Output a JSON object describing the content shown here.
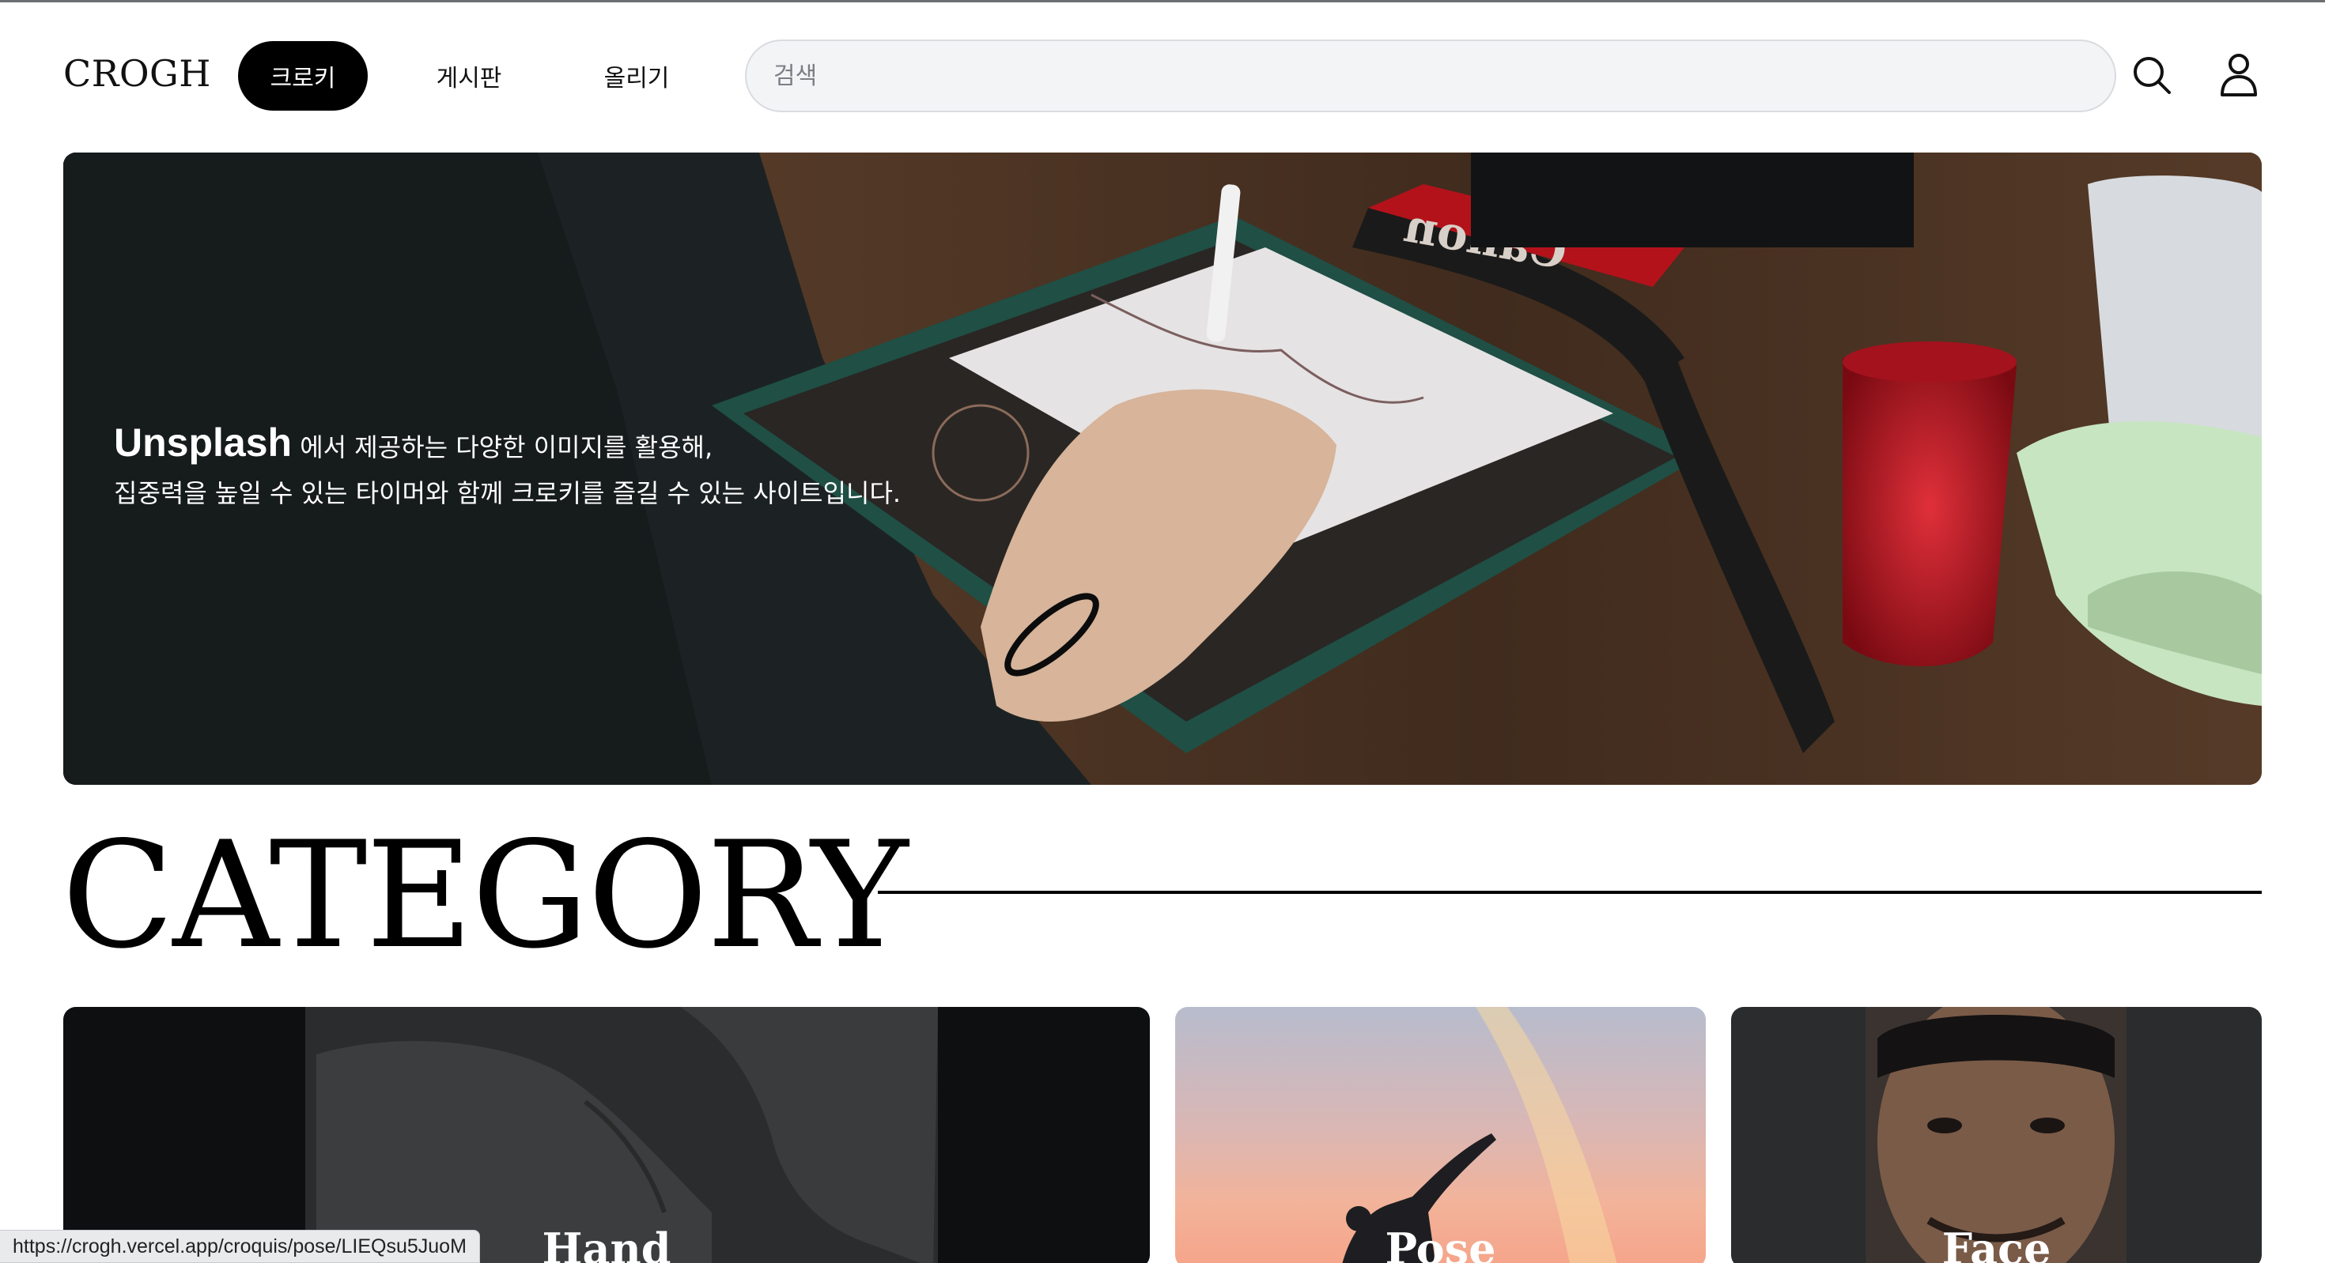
{
  "header": {
    "logo": "CROGH",
    "nav": [
      {
        "label": "크로키",
        "active": true
      },
      {
        "label": "게시판",
        "active": false
      },
      {
        "label": "올리기",
        "active": false
      }
    ],
    "search_placeholder": "검색",
    "search_icon": "search-icon",
    "user_icon": "user-icon"
  },
  "hero": {
    "brand": "Unsplash",
    "line1_rest": " 에서 제공하는 다양한 이미지를 활용해,",
    "line2": "집중력을 높일 수 있는 타이머와 함께 크로키를 즐길 수 있는 사이트입니다."
  },
  "category": {
    "title": "CATEGORY",
    "cards": [
      {
        "label": "Hand"
      },
      {
        "label": "Pose"
      },
      {
        "label": "Face"
      }
    ]
  },
  "status_bar": {
    "url": "https://crogh.vercel.app/croquis/pose/LIEQsu5JuoM"
  },
  "colors": {
    "accent": "#000000",
    "search_bg": "#f3f4f6"
  }
}
